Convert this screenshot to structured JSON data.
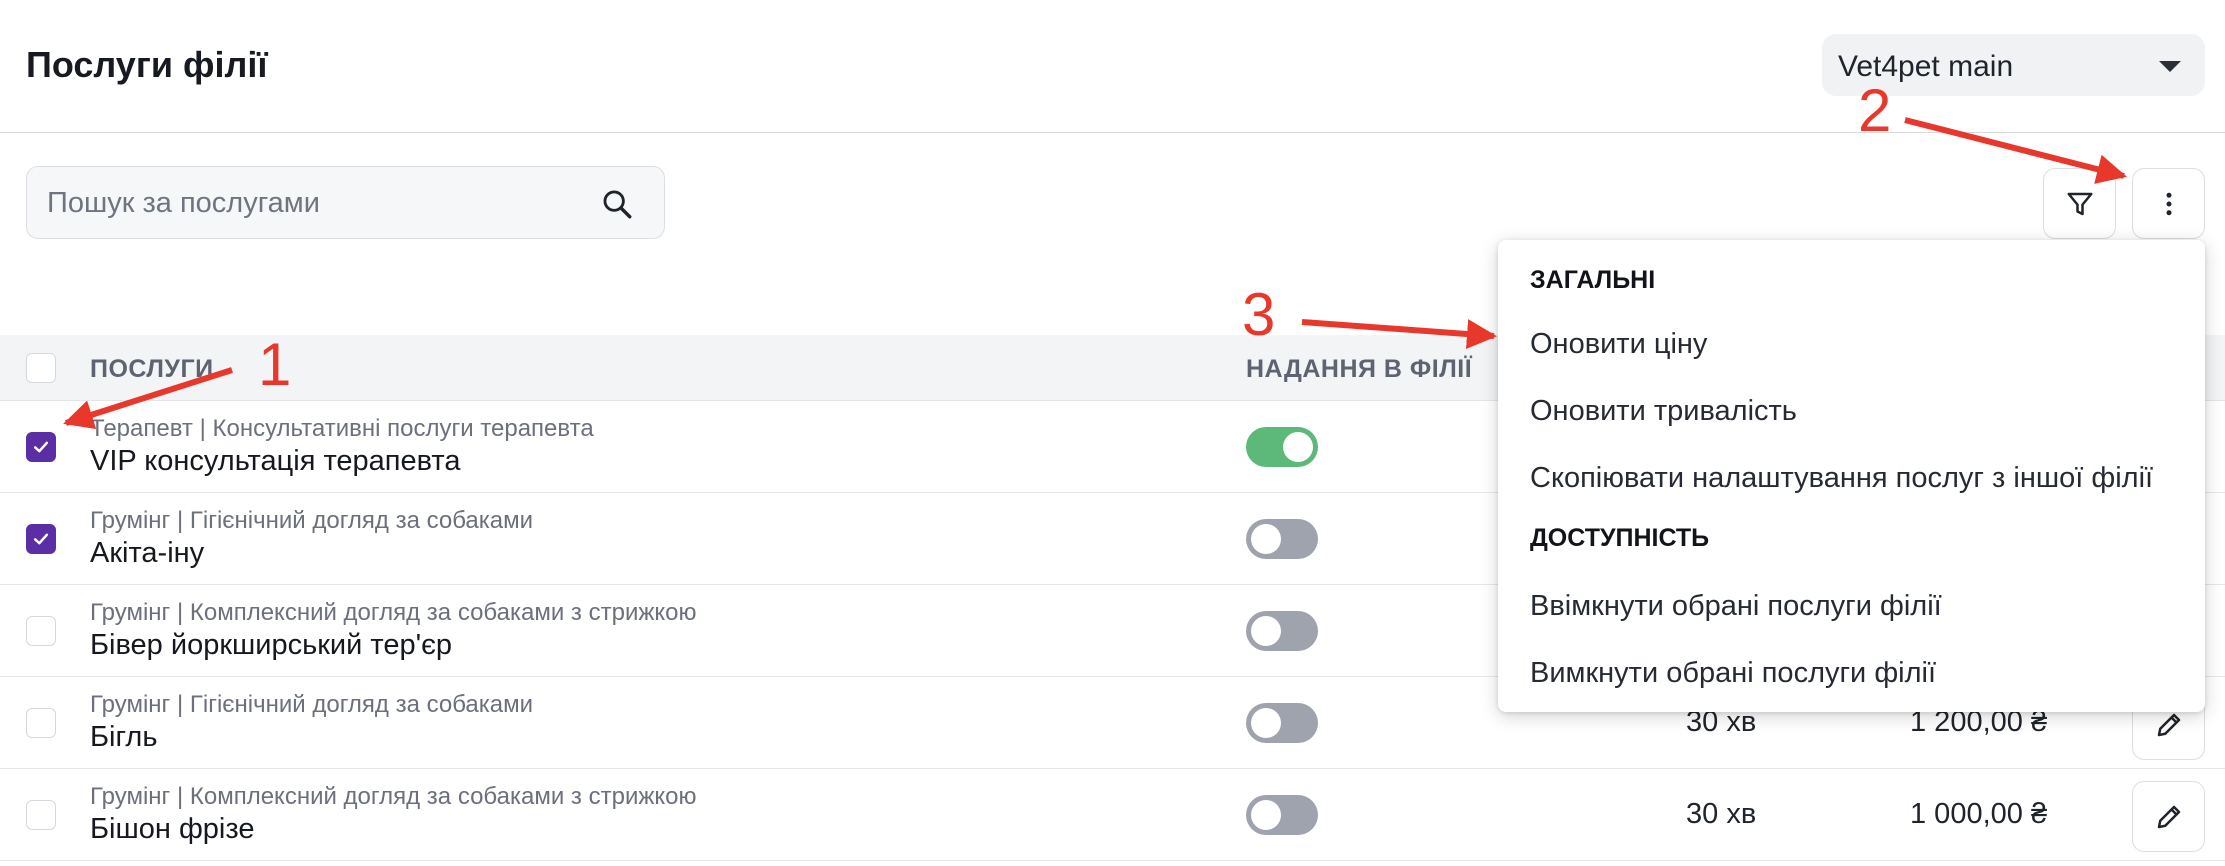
{
  "header": {
    "title": "Послуги філії",
    "branch_select_value": "Vet4pet main"
  },
  "search": {
    "placeholder": "Пошук за послугами"
  },
  "table": {
    "columns": {
      "services": "ПОСЛУГИ",
      "availability": "НАДАННЯ В ФІЛІЇ"
    },
    "rows": [
      {
        "category": "Терапевт | Консультативні послуги терапевта",
        "name": "VIP консультація терапевта",
        "checked": true,
        "enabled": true,
        "duration": "",
        "price": ""
      },
      {
        "category": "Грумінг | Гігієнічний догляд за собаками",
        "name": "Акіта-іну",
        "checked": true,
        "enabled": false,
        "duration": "",
        "price": ""
      },
      {
        "category": "Грумінг | Комплексний догляд за собаками з стрижкою",
        "name": "Бівер йоркширський тер'єр",
        "checked": false,
        "enabled": false,
        "duration": "",
        "price": ""
      },
      {
        "category": "Грумінг | Гігієнічний догляд за собаками",
        "name": "Бігль",
        "checked": false,
        "enabled": false,
        "duration": "30 хв",
        "price": "1 200,00 ₴"
      },
      {
        "category": "Грумінг | Комплексний догляд за собаками з стрижкою",
        "name": "Бішон фрізе",
        "checked": false,
        "enabled": false,
        "duration": "30 хв",
        "price": "1 000,00 ₴"
      }
    ]
  },
  "menu": {
    "section_general": "ЗАГАЛЬНІ",
    "update_price": "Оновити ціну",
    "update_duration": "Оновити тривалість",
    "copy_settings": "Скопіювати налаштування послуг з іншої філії",
    "section_availability": "ДОСТУПНІСТЬ",
    "enable_selected": "Ввімкнути обрані послуги філії",
    "disable_selected": "Вимкнути обрані послуги філії"
  },
  "annotations": {
    "one": "1",
    "two": "2",
    "three": "3"
  },
  "colors": {
    "accent_checkbox": "#5b2ea6",
    "toggle_on": "#5cb97a",
    "toggle_off": "#9ea3ad",
    "annotation": "#e8372b"
  }
}
